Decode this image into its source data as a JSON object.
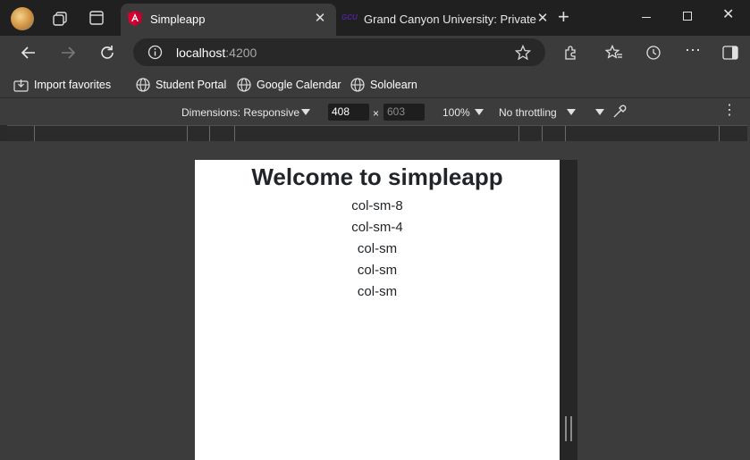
{
  "tabs": [
    {
      "title": "Simpleapp",
      "icon": "angular-icon"
    },
    {
      "title": "Grand Canyon University: Private",
      "icon": "gcu-icon"
    }
  ],
  "address": {
    "host": "localhost",
    "port": ":4200"
  },
  "favorites": [
    "Import favorites",
    "Student Portal",
    "Google Calendar",
    "Sololearn"
  ],
  "devtools": {
    "dimensions_label": "Dimensions: Responsive",
    "width": "408",
    "times": "×",
    "height_placeholder": "603",
    "zoom": "100%",
    "throttling": "No throttling"
  },
  "page": {
    "heading": "Welcome to simpleapp",
    "columns": [
      "col-sm-8",
      "col-sm-4",
      "col-sm",
      "col-sm",
      "col-sm"
    ]
  },
  "colors": {
    "accent_angular": "#dd0031",
    "gcu_purple": "#522398"
  }
}
